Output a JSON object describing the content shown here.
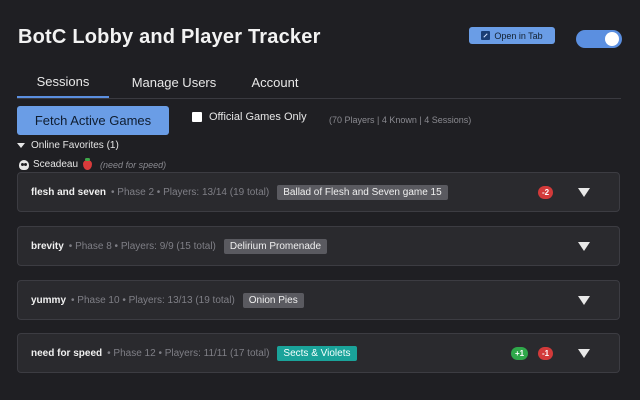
{
  "header": {
    "title": "BotC Lobby and Player Tracker",
    "open_in_tab_label": "Open in Tab",
    "toggle_on": true
  },
  "tabs": [
    {
      "label": "Sessions",
      "active": true
    },
    {
      "label": "Manage Users",
      "active": false
    },
    {
      "label": "Account",
      "active": false
    }
  ],
  "controls": {
    "fetch_label": "Fetch Active Games",
    "official_only_label": "Official Games Only",
    "official_only_checked": false,
    "stats": "(70 Players | 4 Known | 4 Sessions)"
  },
  "favorites": {
    "header": "Online Favorites (1)",
    "expanded": true,
    "players": [
      {
        "name": "Sceadeau",
        "note": "(need for speed)"
      }
    ]
  },
  "sessions": [
    {
      "name": "flesh and seven",
      "meta": "• Phase 2 • Players: 13/14 (19 total)",
      "script": "Ballad of Flesh and Seven game 15",
      "script_color": "gray",
      "badges": [
        {
          "text": "-2",
          "color": "red"
        }
      ]
    },
    {
      "name": "brevity",
      "meta": "• Phase 8 • Players: 9/9 (15 total)",
      "script": "Delirium Promenade",
      "script_color": "gray",
      "badges": []
    },
    {
      "name": "yummy",
      "meta": "• Phase 10 • Players: 13/13 (19 total)",
      "script": "Onion Pies",
      "script_color": "gray",
      "badges": []
    },
    {
      "name": "need for speed",
      "meta": "• Phase 12 • Players: 11/11 (17 total)",
      "script": "Sects & Violets",
      "script_color": "teal",
      "badges": [
        {
          "text": "+1",
          "color": "green"
        },
        {
          "text": "-1",
          "color": "red"
        }
      ]
    }
  ],
  "colors": {
    "background": "#1f1f23",
    "accent": "#6a9de6",
    "card": "#2a2a2e",
    "teal_script": "#1aa39a",
    "badge_red": "#d23a3a",
    "badge_green": "#2fa84a"
  }
}
